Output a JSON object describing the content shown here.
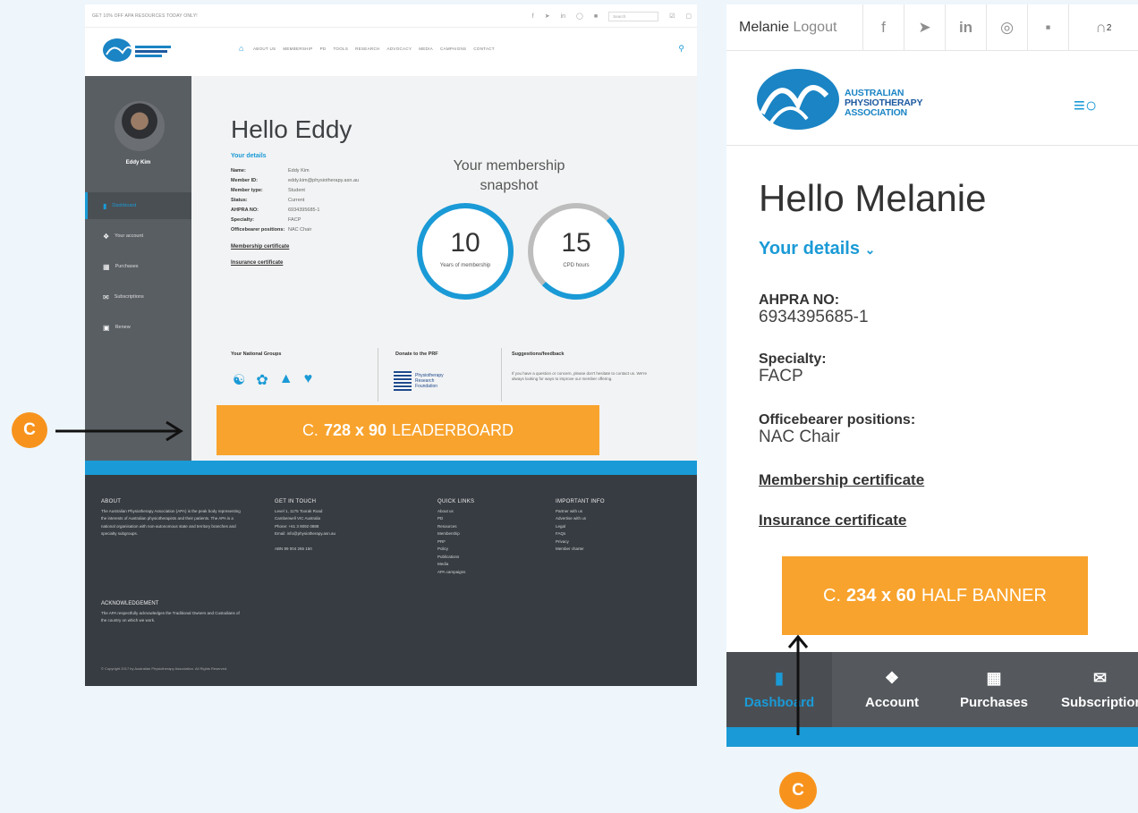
{
  "desktop": {
    "topbar": {
      "promo": "GET 10% OFF APA RESOURCES TODAY ONLY!",
      "search_placeholder": "Search"
    },
    "nav": {
      "items": [
        "ABOUT US",
        "MEMBERSHIP",
        "PD",
        "TOOLS",
        "RESEARCH",
        "ADVOCACY",
        "MEDIA",
        "CAMPAIGNS",
        "CONTACT"
      ]
    },
    "sidebar": {
      "user_name": "Eddy Kim",
      "items": [
        {
          "label": "Dashboard",
          "icon": "bar-chart-icon"
        },
        {
          "label": "Your account",
          "icon": "account-icon"
        },
        {
          "label": "Purchases",
          "icon": "barcode-icon"
        },
        {
          "label": "Subscriptions",
          "icon": "mail-icon"
        },
        {
          "label": "Renew",
          "icon": "renew-icon"
        }
      ]
    },
    "main": {
      "greeting": "Hello Eddy",
      "details_title": "Your details",
      "details": [
        {
          "key": "Name:",
          "value": "Eddy Kim"
        },
        {
          "key": "Member ID:",
          "value": "eddy.kim@physiotherapy.asn.au"
        },
        {
          "key": "Member type:",
          "value": "Student"
        },
        {
          "key": "Status:",
          "value": "Current"
        },
        {
          "key": "AHPRA NO:",
          "value": "6934395685-1"
        },
        {
          "key": "Specialty:",
          "value": "FACP"
        },
        {
          "key": "Officebearer positions:",
          "value": "NAC Chair"
        }
      ],
      "membership_certificate": "Membership certificate",
      "insurance_certificate": "Insurance certificate",
      "snapshot_title": "Your membership snapshot",
      "years_value": "10",
      "years_caption": "Years of membership",
      "cpd_value": "15",
      "cpd_caption": "CPD hours",
      "cpd_progress": 0.7,
      "national_groups_title": "Your National Groups",
      "donate_title": "Donate to the PRF",
      "prf_name": "Physiotherapy Research Foundation",
      "suggestions_title": "Suggestions/feedback",
      "suggestions_text": "If you have a question or concern, please don't hesitate to contact us. We're always looking for ways to improve our member offering.",
      "leaderboard_prefix": "C.",
      "leaderboard_size": "728 x 90",
      "leaderboard_label": "LEADERBOARD"
    },
    "footer": {
      "about_title": "ABOUT",
      "about_text": "The Australian Physiotherapy Association (APA) is the peak body representing the interests of Australian physiotherapists and their patients. The APA is a national organisation with non-autonomous state and territory branches and specialty subgroups.",
      "contact_title": "GET IN TOUCH",
      "contact_lines": [
        "Level 1, 1175 Toorak Road",
        "Camberwell VIC Australia",
        "Phone: +61 3 9092 0888",
        "Email: info@physiotherapy.asn.au"
      ],
      "abn": "ABN 89 004 265 150",
      "quick_title": "QUICK LINKS",
      "quick_links": [
        "About us",
        "PD",
        "Resources",
        "Membership",
        "PRF",
        "Policy",
        "Publications",
        "Media",
        "APA campaigns"
      ],
      "important_title": "IMPORTANT INFO",
      "important_links": [
        "Partner with us",
        "Advertise with us",
        "Legal",
        "FAQs",
        "Privacy",
        "Member charter"
      ],
      "ack_title": "ACKNOWLEDGEMENT",
      "ack_text": "The APA respectfully acknowledges the Traditional Owners and Custodians of the country on which we work.",
      "copyright": "© Copyright 2017 by Australian Physiotherapy Association. All Rights Reserved."
    }
  },
  "mobile": {
    "user_name": "Melanie",
    "logout": "Logout",
    "cart_count": "2",
    "logo_lines": [
      "AUSTRALIAN",
      "PHYSIOTHERAPY",
      "ASSOCIATION"
    ],
    "greeting": "Hello Melanie",
    "details_title": "Your details",
    "fields": [
      {
        "key": "AHPRA NO:",
        "value": "6934395685-1"
      },
      {
        "key": "Specialty:",
        "value": "FACP"
      },
      {
        "key": "Officebearer positions:",
        "value": "NAC Chair"
      }
    ],
    "membership_certificate": "Membership certificate",
    "insurance_certificate": "Insurance certificate",
    "banner_prefix": "C.",
    "banner_size": "234 x 60",
    "banner_label": "HALF BANNER",
    "tabs": [
      {
        "label": "Dashboard",
        "icon": "bar-chart-icon"
      },
      {
        "label": "Account",
        "icon": "account-icon"
      },
      {
        "label": "Purchases",
        "icon": "barcode-icon"
      },
      {
        "label": "Subscriptions",
        "icon": "mail-icon"
      }
    ]
  },
  "annotations": {
    "marker_letter": "C",
    "marker_color": "#f7931d"
  },
  "colors": {
    "accent": "#1a9ad6",
    "ad_orange": "#f8a32d",
    "sidebar": "#595e63",
    "footer": "#373c42"
  }
}
